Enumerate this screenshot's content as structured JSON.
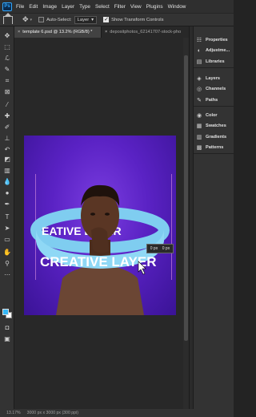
{
  "menu": {
    "logo": "Ps",
    "items": [
      "File",
      "Edit",
      "Image",
      "Layer",
      "Type",
      "Select",
      "Filter",
      "View",
      "Plugins",
      "Window"
    ]
  },
  "options": {
    "auto_select_label": "Auto-Select:",
    "auto_select_value": "Layer",
    "transform_label": "Show Transform Controls"
  },
  "tabs": [
    {
      "label": "template 6.psd @ 13.2% (RGB/8) *",
      "close": "×"
    },
    {
      "label": "depositphotos_62141707-stock-pho",
      "close": "×"
    }
  ],
  "panels": {
    "group1": [
      {
        "label": "Properties",
        "icon": "properties-icon"
      },
      {
        "label": "Adjustme...",
        "icon": "adjustments-icon"
      },
      {
        "label": "Libraries",
        "icon": "libraries-icon"
      }
    ],
    "group2": [
      {
        "label": "Layers",
        "icon": "layers-icon"
      },
      {
        "label": "Channels",
        "icon": "channels-icon"
      },
      {
        "label": "Paths",
        "icon": "paths-icon"
      }
    ],
    "group3": [
      {
        "label": "Color",
        "icon": "color-icon"
      },
      {
        "label": "Swatches",
        "icon": "swatches-icon"
      },
      {
        "label": "Gradients",
        "icon": "gradients-icon"
      },
      {
        "label": "Patterns",
        "icon": "patterns-icon"
      }
    ]
  },
  "canvas": {
    "ring_text": "CREATIVE LAYER",
    "ring_text_back": "EATIVE LAYER",
    "readout_a": "0 px",
    "readout_b": "0 px",
    "background_color": "#5a22c4",
    "ring_color": "#8fd8f5"
  },
  "status": {
    "zoom": "13.17%",
    "doc": "3000 px x 3000 px (300 ppi)"
  },
  "colors": {
    "foreground": "#35b6f5",
    "background": "#ffffff"
  }
}
